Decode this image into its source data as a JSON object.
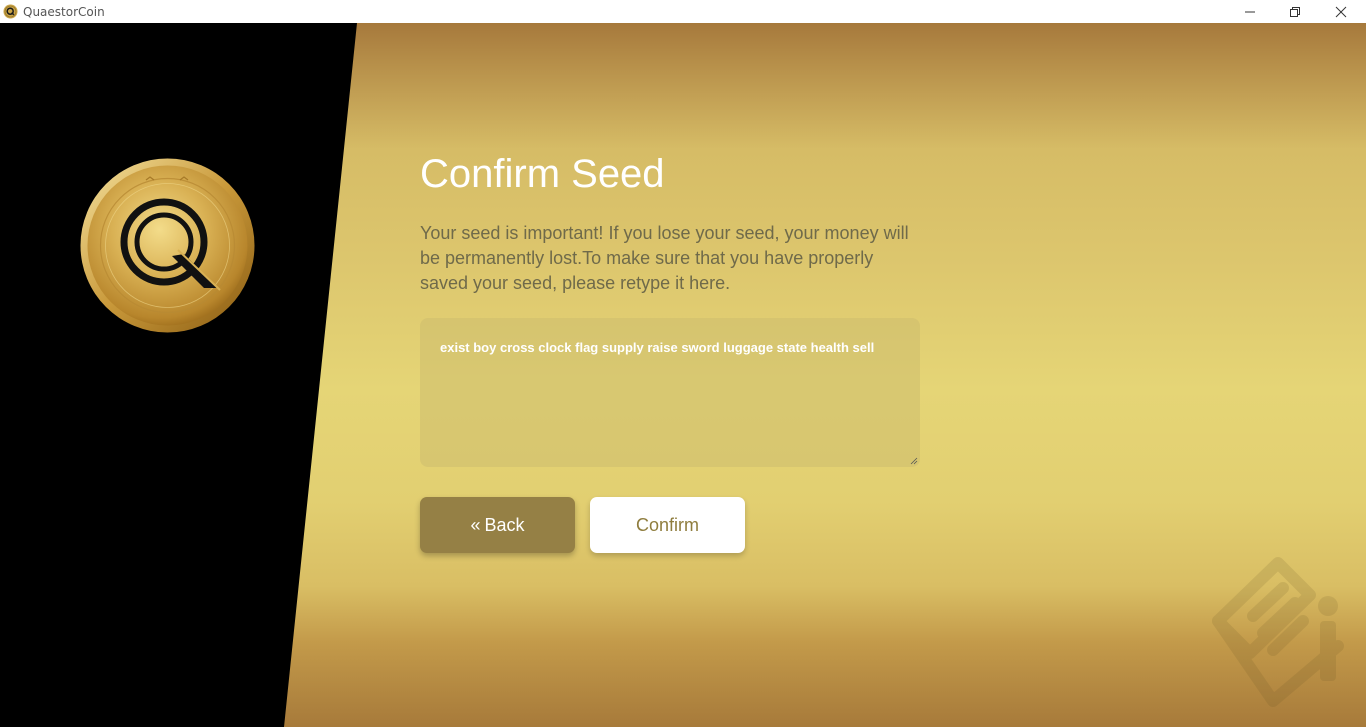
{
  "window": {
    "title": "QuaestorCoin",
    "icon": "coin-app-icon",
    "controls": [
      "minimize-icon",
      "maximize-icon",
      "close-icon"
    ]
  },
  "page": {
    "title": "Confirm Seed",
    "description": "Your seed is important! If you lose your seed, your money will be permanently lost.To make sure that you have properly saved your seed, please retype it here.",
    "seed_value": "exist boy cross clock flag supply raise sword luggage state health sell"
  },
  "buttons": {
    "back_icon": "«",
    "back_label": "Back",
    "confirm_label": "Confirm"
  },
  "logo": {
    "icon": "quaestor-coin-logo"
  },
  "decor": {
    "watermark_icon": "document-edit-icon"
  },
  "colors": {
    "gold_accent": "#d4af37",
    "panel_black": "#000000",
    "back_button": "#958045",
    "confirm_text": "#8f7d3e"
  }
}
